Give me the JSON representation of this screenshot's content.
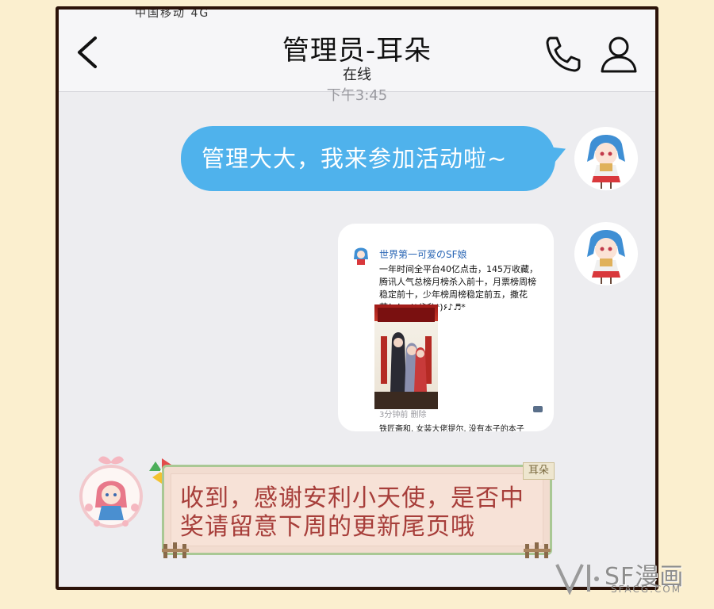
{
  "header": {
    "title": "管理员-耳朵",
    "status": "在线",
    "cutoff_text": "中国移动 4G",
    "back_icon": "chevron-left-icon",
    "call_icon": "phone-icon",
    "profile_icon": "user-icon"
  },
  "timestamp": "下午3:45",
  "messages": {
    "sent_text": "管理大大，我来参加活动啦~",
    "card": {
      "title": "世界第一可爱のSF娘",
      "body": "一年时间全平台40亿点击，145万收藏，腾讯人气总榜月榜杀入前十，月票榜周榜稳定前十，少年榜周榜稳定前五，撒花花！！٩(*´︶`*)۶♪♬*",
      "footer_left": "3分钟前  删除",
      "caption": "铁匠斋和, 女装大佬提尔, 没有本子的本子"
    },
    "received_text": "收到，感谢安利小天使，是否中奖请留意下周的更新尾页哦",
    "received_name_tag": "耳朵"
  },
  "watermark": {
    "main": "SF漫画",
    "sub": "SFACG.COM"
  },
  "colors": {
    "sent_bubble": "#4fb2ec",
    "received_text": "#a73e3a",
    "background": "#fbefcf",
    "frame": "#2b1208"
  }
}
